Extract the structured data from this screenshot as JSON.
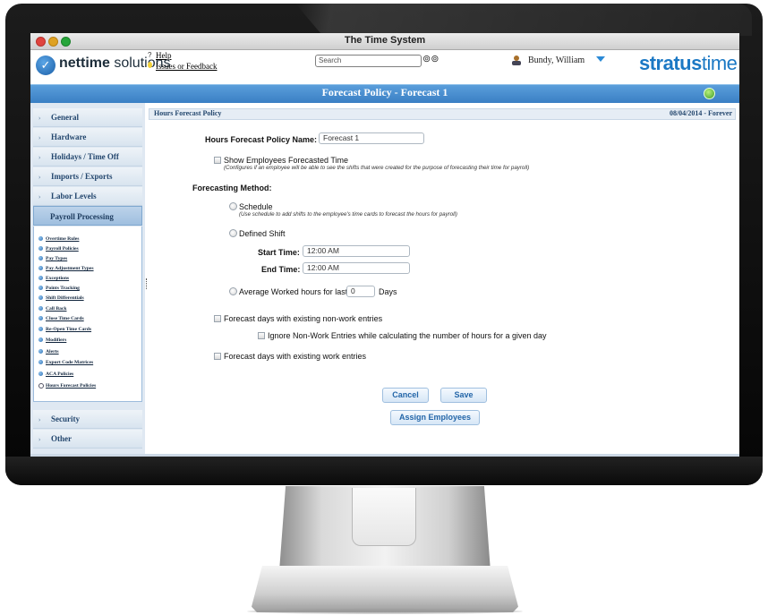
{
  "window": {
    "title": "The Time System"
  },
  "header": {
    "logo_prefix": "nettime",
    "logo_suffix": " solutions",
    "help_link": "Help",
    "feedback_link": "Issues or Feedback",
    "search_placeholder": "Search",
    "user_name": "Bundy, William",
    "brand_bold": "stratus",
    "brand_thin": "time"
  },
  "page": {
    "title": "Forecast Policy - Forecast 1"
  },
  "sidebar": {
    "sections_top": [
      "General",
      "Hardware",
      "Holidays / Time Off",
      "Imports / Exports",
      "Labor Levels"
    ],
    "active_section": "Payroll Processing",
    "sub_items": [
      "Overtime Rules",
      "Payroll Policies",
      "Pay Types",
      "Pay Adjustment Types",
      "Exceptions",
      "Points Tracking",
      "Shift Differentials",
      "Call Back",
      "Close Time Cards",
      "Re-Open Time Cards",
      "Modifiers",
      "Alerts",
      "Export Code Matrices",
      "ACA Policies",
      "Hours Forecast Policies"
    ],
    "selected_sub_item": "Hours Forecast Policies",
    "sections_bottom": [
      "Security",
      "Other"
    ]
  },
  "form": {
    "section_title": "Hours Forecast Policy",
    "date_range": "08/04/2014 - Forever",
    "policy_name_label": "Hours Forecast Policy Name:",
    "policy_name_value": "Forecast 1",
    "show_forecasted_label": "Show Employees Forecasted Time",
    "show_forecasted_note": "(Configures if an employee will be able to see the shifts that were created for the purpose of forecasting their time for payroll)",
    "method_label": "Forecasting Method:",
    "schedule_label": "Schedule",
    "schedule_note": "(Use schedule to add shifts to the employee's time cards to forecast the hours for payroll)",
    "defined_shift_label": "Defined Shift",
    "start_time_label": "Start Time:",
    "start_time_value": "12:00 AM",
    "end_time_label": "End Time:",
    "end_time_value": "12:00 AM",
    "average_label": "Average Worked hours for last",
    "average_days_value": "0",
    "average_days_unit": "Days",
    "nonwork_label": "Forecast days with existing non-work entries",
    "ignore_nonwork_label": "Ignore Non-Work Entries while calculating the number of hours for a given day",
    "work_label": "Forecast days with existing work entries",
    "cancel_label": "Cancel",
    "save_label": "Save",
    "assign_label": "Assign Employees"
  },
  "colors": {
    "accent_blue": "#3a7fc4",
    "brand_blue": "#1b78c4",
    "nav_text": "#24476e"
  }
}
